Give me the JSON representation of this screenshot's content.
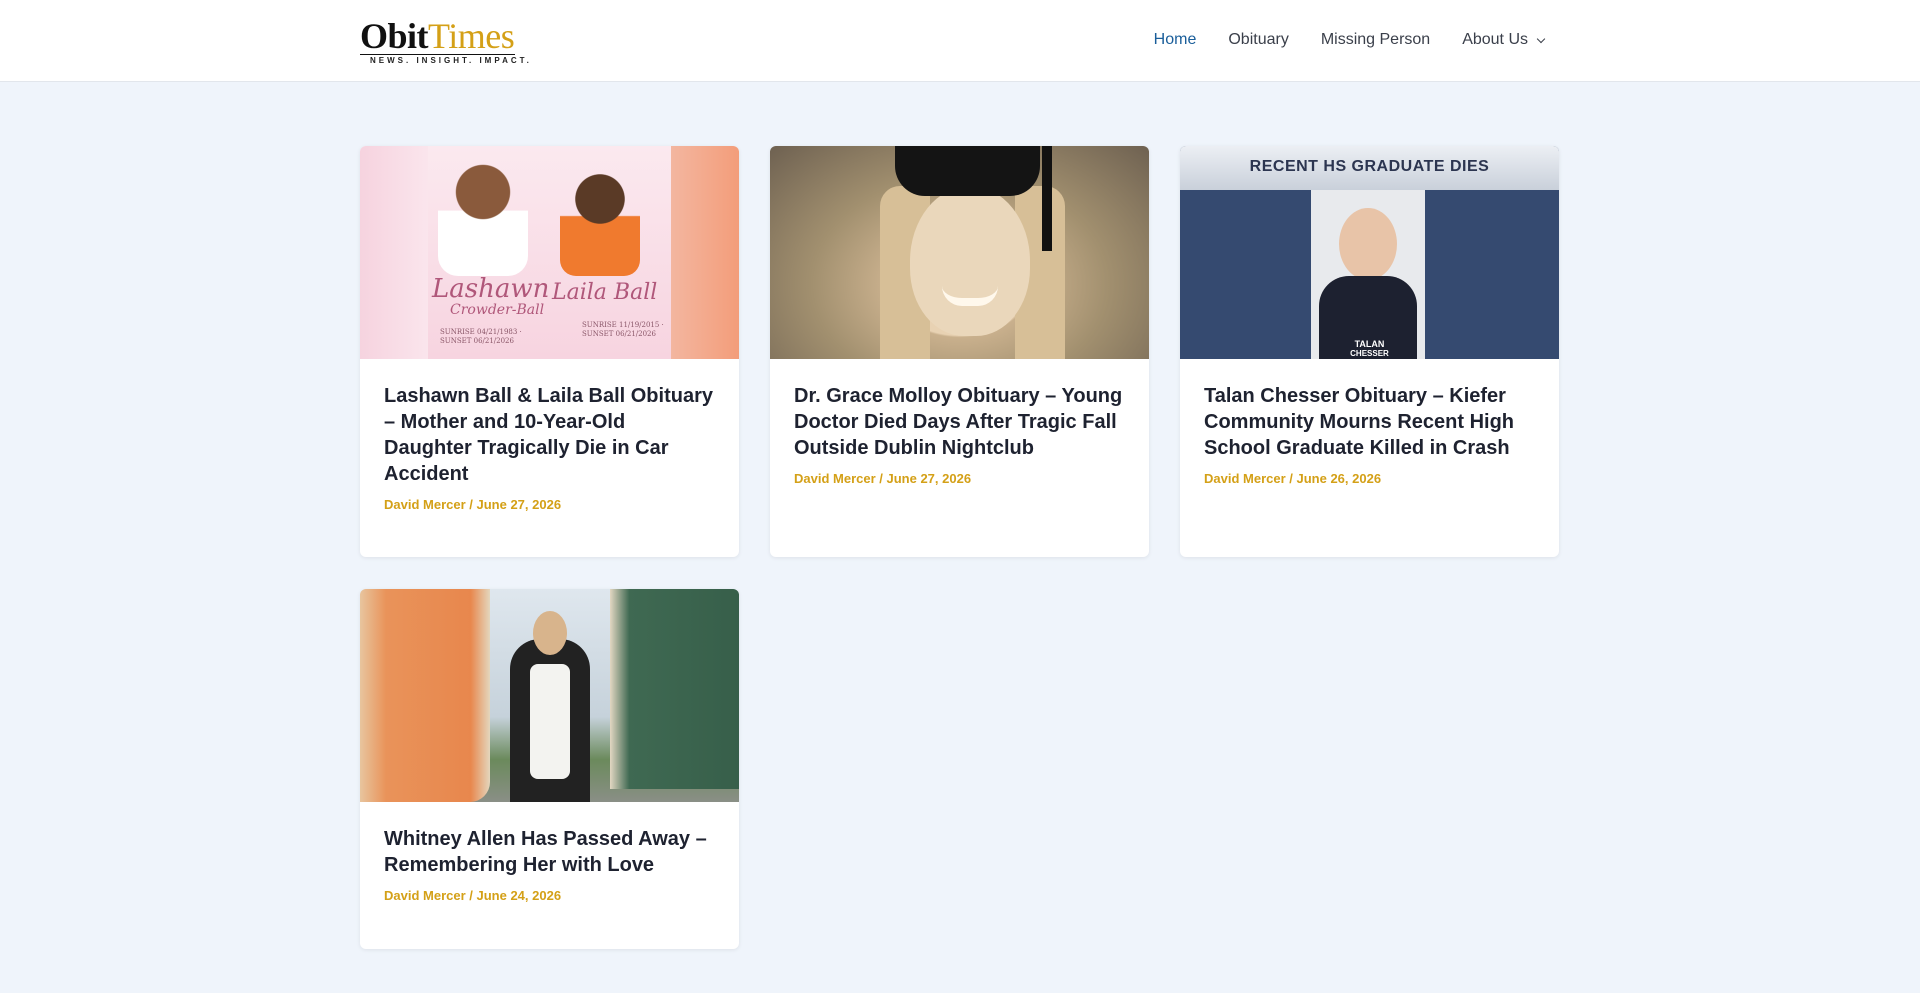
{
  "site": {
    "logo_obit": "Obit",
    "logo_times": "Times",
    "logo_tagline": "NEWS. INSIGHT. IMPACT."
  },
  "nav": [
    {
      "label": "Home",
      "active": true
    },
    {
      "label": "Obituary",
      "active": false
    },
    {
      "label": "Missing Person",
      "active": false
    },
    {
      "label": "About Us",
      "active": false,
      "has_dropdown": true
    }
  ],
  "posts": [
    {
      "title": "Lashawn Ball & Laila Ball Obituary – Mother and 10-Year-Old Daughter Tragically Die in Car Accident",
      "author": "David Mercer",
      "separator": " / ",
      "date": "June 27, 2026",
      "thumb": {
        "name_left": "Lashawn",
        "name_left_sub": "Crowder-Ball",
        "dates_left": "SUNRISE 04/21/1983 · SUNSET 06/21/2026",
        "name_right": "Laila Ball",
        "dates_right": "SUNRISE 11/19/2015 · SUNSET 06/21/2026"
      }
    },
    {
      "title": "Dr. Grace Molloy Obituary – Young Doctor Died Days After Tragic Fall Outside Dublin Nightclub",
      "author": "David Mercer",
      "separator": " / ",
      "date": "June 27, 2026"
    },
    {
      "title": "Talan Chesser Obituary – Kiefer Community Mourns Recent High School Graduate Killed in Crash",
      "author": "David Mercer",
      "separator": " / ",
      "date": "June 26, 2026",
      "thumb": {
        "banner": "RECENT HS GRADUATE DIES",
        "first_name": "TALAN",
        "last_name": "CHESSER"
      }
    },
    {
      "title": "Whitney Allen Has Passed Away – Remembering Her with Love",
      "author": "David Mercer",
      "separator": " / ",
      "date": "June 24, 2026"
    }
  ]
}
